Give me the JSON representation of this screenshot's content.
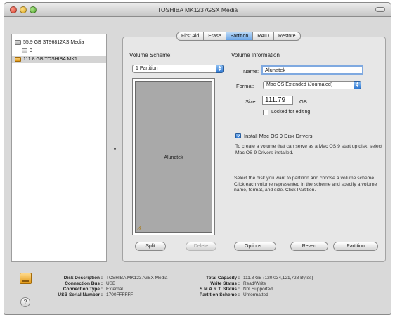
{
  "window": {
    "title": "TOSHIBA MK1237GSX Media"
  },
  "sidebar": {
    "items": [
      {
        "label": "55.9 GB ST96812AS Media",
        "icon": "internal-disk-icon"
      },
      {
        "label": "0",
        "icon": "volume-icon"
      },
      {
        "label": "111.8 GB TOSHIBA MK1...",
        "icon": "external-disk-icon",
        "selected": true
      }
    ]
  },
  "tabs": [
    "First Aid",
    "Erase",
    "Partition",
    "RAID",
    "Restore"
  ],
  "active_tab": "Partition",
  "scheme": {
    "title": "Volume Scheme:",
    "selected": "1 Partition",
    "partition_name": "Alunatek"
  },
  "info": {
    "title": "Volume Information",
    "name_label": "Name:",
    "name_value": "Alunatek",
    "format_label": "Format:",
    "format_value": "Mac OS Extended (Journaled)",
    "size_label": "Size:",
    "size_value": "111.79",
    "size_unit": "GB",
    "locked_label": "Locked for editing",
    "install_label": "Install Mac OS 9 Disk Drivers",
    "install_desc": "To create a volume that can serve as a Mac OS 9 start up disk, select Mac OS 9 Drivers installed.",
    "instructions": "Select the disk you want to partition and choose a volume scheme. Click each volume represented in the scheme and specify a volume name, format, and size. Click Partition."
  },
  "buttons": {
    "split": "Split",
    "delete": "Delete",
    "options": "Options...",
    "revert": "Revert",
    "partition": "Partition"
  },
  "footer": {
    "disk_description_label": "Disk Description :",
    "disk_description": "TOSHIBA MK1237GSX Media",
    "connection_bus_label": "Connection Bus :",
    "connection_bus": "USB",
    "connection_type_label": "Connection Type :",
    "connection_type": "External",
    "usb_serial_label": "USB Serial Number :",
    "usb_serial": "1700FFFFFF",
    "total_capacity_label": "Total Capacity :",
    "total_capacity": "111.8 GB (120,034,121,728 Bytes)",
    "write_status_label": "Write Status :",
    "write_status": "Read/Write",
    "smart_label": "S.M.A.R.T. Status :",
    "smart": "Not Supported",
    "partition_scheme_label": "Partition Scheme :",
    "partition_scheme": "Unformatted",
    "help": "?"
  }
}
